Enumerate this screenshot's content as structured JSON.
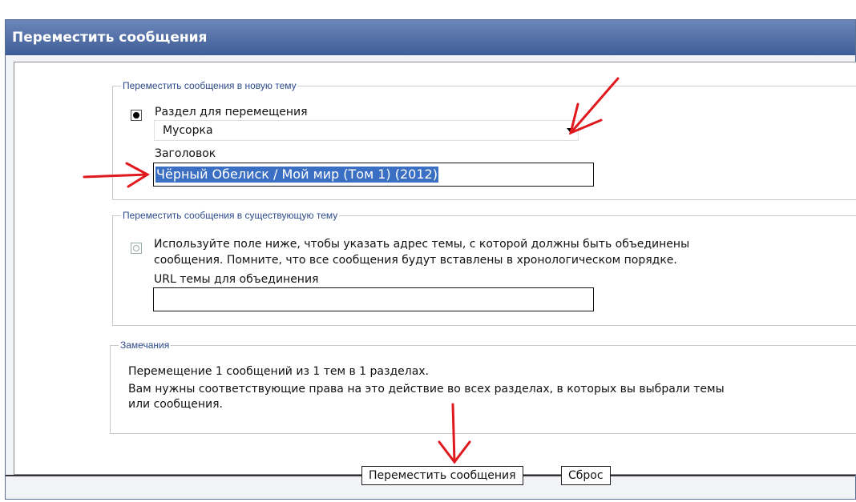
{
  "window": {
    "title": "Переместить сообщения"
  },
  "new_topic": {
    "legend": "Переместить сообщения в новую тему",
    "section_label": "Раздел для перемещения",
    "section_value": "Мусорка",
    "title_label": "Заголовок",
    "title_value": "Чёрный Обелиск / Мой мир (Том 1) (2012)"
  },
  "existing_topic": {
    "legend": "Переместить сообщения в существующую тему",
    "description_line1": "Используйте поле ниже, чтобы указать адрес темы, с которой должны быть объединены",
    "description_line2": "сообщения. Помните, что все сообщения будут вставлены в хронологическом порядке.",
    "url_label": "URL темы для объединения",
    "url_value": ""
  },
  "notes": {
    "legend": "Замечания",
    "line1": "Перемещение 1 сообщений из 1 тем в 1 разделах.",
    "line2": "Вам нужны соответствующие права на это действие во всех разделах, в которых вы выбрали темы",
    "line3": "или сообщения."
  },
  "buttons": {
    "submit": "Переместить сообщения",
    "reset": "Сброс"
  },
  "annotations": {
    "arrow_color": "#e0191e"
  },
  "colors": {
    "title_bar": "#4a669f",
    "selection": "#3b6fc4",
    "legend_text": "#2d4a8a"
  }
}
